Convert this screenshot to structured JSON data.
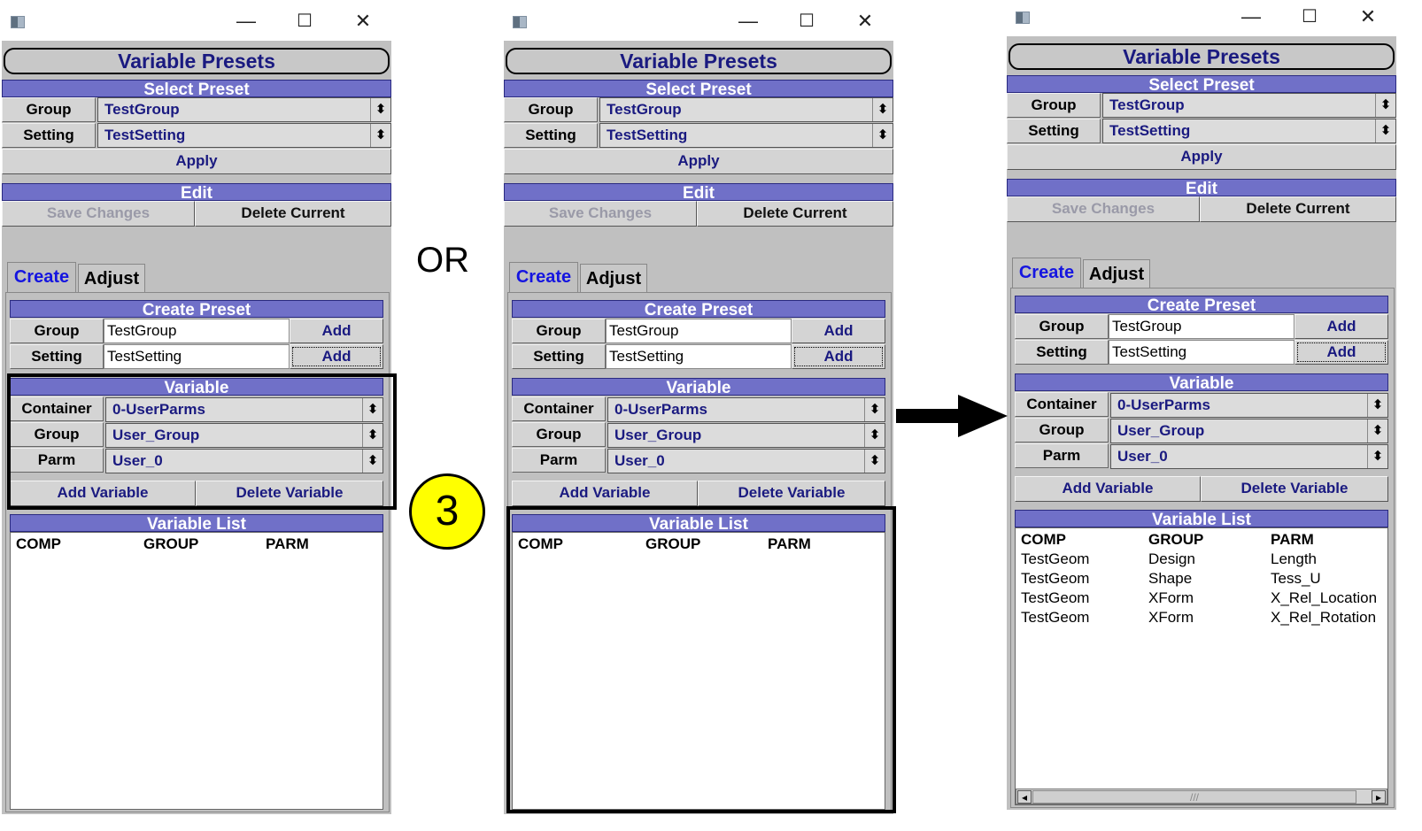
{
  "window": {
    "title_controls": {
      "minimize": "—",
      "maximize": "☐",
      "close": "✕"
    },
    "title": "Variable Presets",
    "select_preset": {
      "header": "Select Preset",
      "group_label": "Group",
      "group_value": "TestGroup",
      "setting_label": "Setting",
      "setting_value": "TestSetting",
      "apply_label": "Apply"
    },
    "edit": {
      "header": "Edit",
      "save_changes_label": "Save Changes",
      "delete_current_label": "Delete Current"
    },
    "tabs": {
      "create": "Create",
      "adjust": "Adjust"
    },
    "create_preset": {
      "header": "Create Preset",
      "group_label": "Group",
      "group_value": "TestGroup",
      "setting_label": "Setting",
      "setting_value": "TestSetting",
      "add_label": "Add"
    },
    "variable": {
      "header": "Variable",
      "container_label": "Container",
      "container_value": "0-UserParms",
      "group_label": "Group",
      "group_value": "User_Group",
      "parm_label": "Parm",
      "parm_value": "User_0",
      "add_variable_label": "Add Variable",
      "delete_variable_label": "Delete Variable"
    },
    "variable_list": {
      "header": "Variable List",
      "columns": [
        "COMP",
        "GROUP",
        "PARM"
      ]
    },
    "dropdown_arrow": "⬍"
  },
  "annotations": {
    "or_text": "OR",
    "step_number": "3"
  },
  "final_list_rows": [
    [
      "TestGeom",
      "Design",
      "Length"
    ],
    [
      "TestGeom",
      "Shape",
      "Tess_U"
    ],
    [
      "TestGeom",
      "XForm",
      "X_Rel_Location"
    ],
    [
      "TestGeom",
      "XForm",
      "X_Rel_Rotation"
    ]
  ],
  "scrollbar": {
    "left_arrow": "◂",
    "right_arrow": "▸",
    "grip": "///"
  }
}
